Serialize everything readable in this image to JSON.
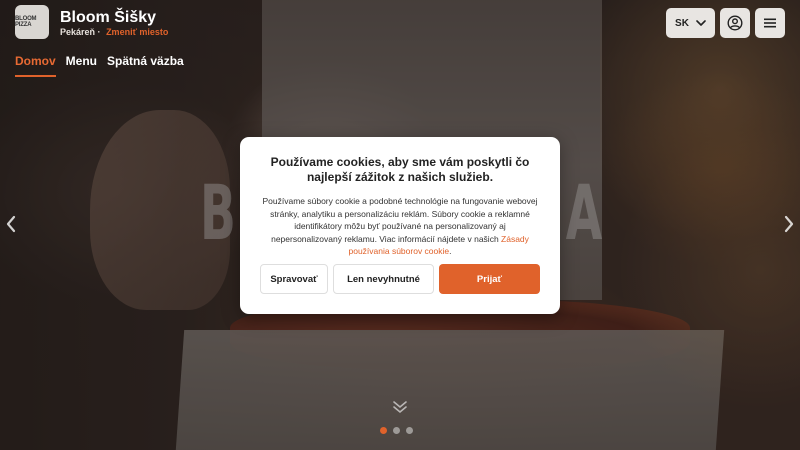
{
  "brand": {
    "logo_text": "BLOOM PIZZA",
    "name": "Bloom Šišky",
    "subtitle": "Pekáreň",
    "change_location": "Zmeniť miesto"
  },
  "nav": [
    {
      "label": "Domov",
      "active": true
    },
    {
      "label": "Menu",
      "active": false
    },
    {
      "label": "Spätná väzba",
      "active": false
    }
  ],
  "header_actions": {
    "language": "SK",
    "language_icon": "chevron-down-icon",
    "account_icon": "user-circle-icon",
    "menu_icon": "hamburger-menu-icon"
  },
  "hero": {
    "background_text_left": "BL",
    "background_text_right": "A",
    "slide_count": 3,
    "active_slide": 1,
    "left_arrow_icon": "chevron-left-icon",
    "right_arrow_icon": "chevron-right-icon",
    "scroll_icon": "chevron-down-icon"
  },
  "cookie_modal": {
    "title": "Používame cookies, aby sme vám poskytli čo najlepší zážitok z našich služieb.",
    "body": "Používame súbory cookie a podobné technológie na fungovanie webovej stránky, analytiku a personalizáciu reklám. Súbory cookie a reklamné identifikátory môžu byť používané na personalizovaný aj nepersonalizovaný reklamu. Viac informácií nájdete v našich ",
    "policy_link": "Zásady používania súborov cookie",
    "body_end": ".",
    "buttons": {
      "manage": "Spravovať",
      "necessary_only": "Len nevyhnutné",
      "accept": "Prijať"
    }
  },
  "colors": {
    "accent": "#e0622b",
    "header_button_bg": "#e8e5e2",
    "modal_bg": "#ffffff"
  }
}
